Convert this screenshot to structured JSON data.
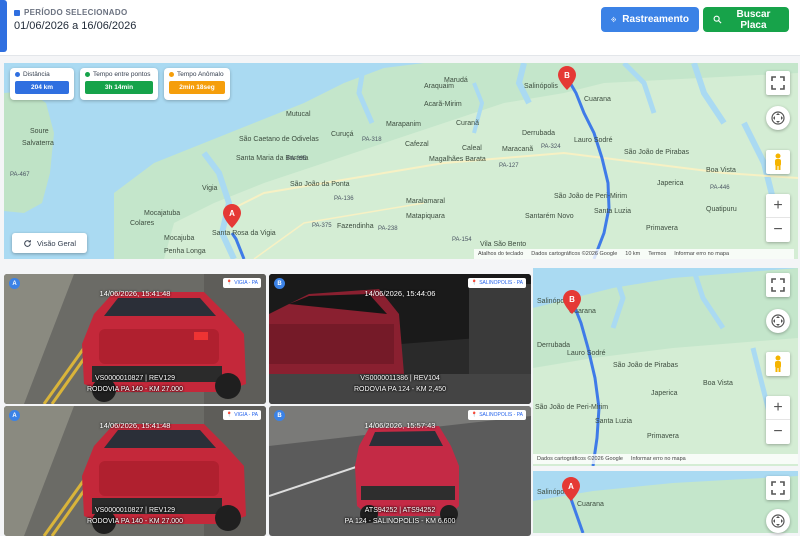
{
  "header": {
    "period_label": "PERÍODO SELECIONADO",
    "period_value": "01/06/2026 a 16/06/2026",
    "tracking_button": "Rastreamento",
    "search_plate_button": "Buscar Placa"
  },
  "colors": {
    "primary": "#3b82e6",
    "success": "#17a34a",
    "warning": "#f59e0b",
    "route": "#3f7be8",
    "pin": "#e53935"
  },
  "map_main": {
    "stats": [
      {
        "title": "Distância",
        "value": "204 km",
        "color": "#2f6fe0"
      },
      {
        "title": "Tempo entre pontos",
        "value": "3h 14min",
        "color": "#16a34a"
      },
      {
        "title": "Tempo Anômalo",
        "value": "2min 18seg",
        "color": "#f59e0b"
      }
    ],
    "overview_button": "Visão Geral",
    "pins": {
      "a": "A",
      "b": "B"
    },
    "places": {
      "p1": "Soure",
      "p2": "Salvaterra",
      "p3": "Salinópolis",
      "p4": "Cuarana",
      "p5": "Marudá",
      "p6": "Curuçá",
      "p7": "Marapanim",
      "p8": "Mutucal",
      "p9": "Araquaim",
      "p10": "Acarã-Mirim",
      "p11": "Curanã",
      "p12": "Primavera",
      "p13": "Quatipuru",
      "p14": "Boa Vista",
      "p15": "Japerica",
      "p16": "Derrubada",
      "p17": "Lauro Sodré",
      "p18": "São João de Pirabas",
      "p19": "Santa Luzia",
      "p20": "Santarém Novo",
      "p21": "São João de Peri-Mirim",
      "p22": "Maracanã",
      "p23": "Magalhães Barata",
      "p24": "Caleal",
      "p25": "Cafezal",
      "p26": "São Caetano de Odivelas",
      "p27": "Santa Maria da Barreta",
      "p28": "São João da Ponta",
      "p29": "Vigia",
      "p30": "Mocajatuba",
      "p31": "Colares",
      "p32": "Penha Longa",
      "p33": "Santa Rosa da Vigia",
      "p34": "Fazendinha",
      "p35": "Vila São Bento",
      "p36": "Matapiquara",
      "p37": "Maralamaral",
      "p38": "Mocajuba"
    },
    "roads": [
      "PA-375",
      "PA-136",
      "PA-318",
      "PA-446",
      "PA-127",
      "PA-324",
      "PA-238",
      "PA-154",
      "PA-467",
      "PA-395"
    ],
    "footer": {
      "shortcuts": "Atalhos do teclado",
      "copyright": "Dados cartográficos ©2026 Google",
      "scale": "10 km",
      "terms": "Termos",
      "report": "Informar erro no mapa"
    }
  },
  "captures": [
    {
      "letter": "A",
      "location": "VIGIA - PA",
      "timestamp": "14/06/2026, 15:41:48",
      "line1": "VS0000010827 | REV129",
      "line2": "RODOVIA PA 140 - KM 27.000"
    },
    {
      "letter": "B",
      "location": "SALINOPOLIS - PA",
      "timestamp": "14/06/2026, 15:44:06",
      "line1": "VS0000011386 | REV104",
      "line2": "RODOVIA PA 124 - KM 2,450"
    },
    {
      "letter": "A",
      "location": "VIGIA - PA",
      "timestamp": "14/06/2026, 15:41:48",
      "line1": "VS0000010827 | REV129",
      "line2": "RODOVIA PA 140 - KM 27.000"
    },
    {
      "letter": "B",
      "location": "SALINOPOLIS - PA",
      "timestamp": "14/06/2026, 15:57:43",
      "line1": "ATS94252 | ATS94252",
      "line2": "PA 124 - SALINOPOLIS - KM 6.600"
    }
  ],
  "mini_map_1": {
    "pin": "B",
    "places": {
      "m1": "Cuarana",
      "m2": "Derrubada",
      "m3": "Lauro Sodré",
      "m4": "São João de Pirabas",
      "m5": "Boa Vista",
      "m6": "Japerica",
      "m7": "Primavera",
      "m8": "Santa Luzia",
      "m9": "São João de Peri-Mirim",
      "m10": "Salinópolis"
    },
    "footer": {
      "copyright": "Dados cartográficos ©2026 Google",
      "report": "Informar erro no mapa"
    }
  },
  "mini_map_2": {
    "pin": "A",
    "places": {
      "n1": "Salinópolis",
      "n2": "Cuarana"
    }
  }
}
